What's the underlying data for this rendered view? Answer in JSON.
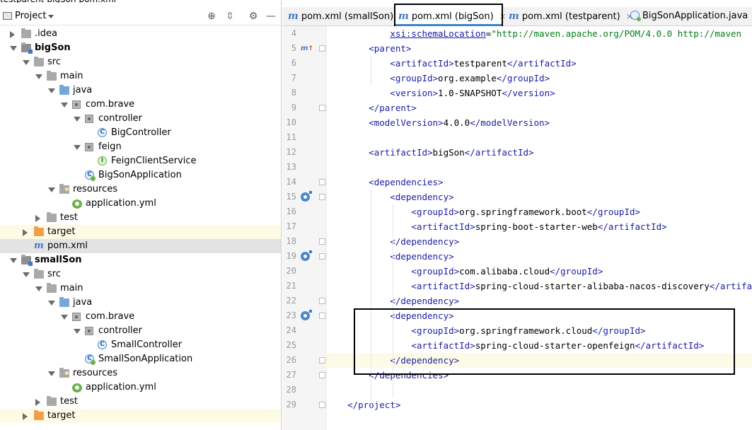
{
  "breadcrumb": [
    "testparent",
    "bigSon",
    "pom.xml"
  ],
  "project_panel": {
    "title": "Project",
    "tree": [
      {
        "label": ".idea",
        "icon": "folder-icon",
        "depth": 1,
        "arrow": "closed"
      },
      {
        "label": "bigSon",
        "icon": "module-folder-icon",
        "depth": 1,
        "arrow": "open",
        "bold": true
      },
      {
        "label": "src",
        "icon": "folder-icon",
        "depth": 2,
        "arrow": "open"
      },
      {
        "label": "main",
        "icon": "folder-icon",
        "depth": 3,
        "arrow": "open"
      },
      {
        "label": "java",
        "icon": "source-folder-icon",
        "depth": 4,
        "arrow": "open"
      },
      {
        "label": "com.brave",
        "icon": "package-icon",
        "depth": 5,
        "arrow": "open"
      },
      {
        "label": "controller",
        "icon": "package-icon",
        "depth": 6,
        "arrow": "open"
      },
      {
        "label": "BigController",
        "icon": "class-icon",
        "depth": 7
      },
      {
        "label": "feign",
        "icon": "package-icon",
        "depth": 6,
        "arrow": "open"
      },
      {
        "label": "FeignClientService",
        "icon": "interface-icon",
        "depth": 7
      },
      {
        "label": "BigSonApplication",
        "icon": "spring-app-icon",
        "depth": 6
      },
      {
        "label": "resources",
        "icon": "resources-folder-icon",
        "depth": 4,
        "arrow": "open"
      },
      {
        "label": "application.yml",
        "icon": "yml-icon",
        "depth": 5
      },
      {
        "label": "test",
        "icon": "folder-icon",
        "depth": 3,
        "arrow": "closed"
      },
      {
        "label": "target",
        "icon": "target-folder-icon",
        "depth": 2,
        "arrow": "closed",
        "highlight": "yellow"
      },
      {
        "label": "pom.xml",
        "icon": "maven-icon",
        "depth": 2,
        "highlight": "selected"
      },
      {
        "label": "smallSon",
        "icon": "module-folder-icon",
        "depth": 1,
        "arrow": "open",
        "bold": true
      },
      {
        "label": "src",
        "icon": "folder-icon",
        "depth": 2,
        "arrow": "open"
      },
      {
        "label": "main",
        "icon": "folder-icon",
        "depth": 3,
        "arrow": "open"
      },
      {
        "label": "java",
        "icon": "source-folder-icon",
        "depth": 4,
        "arrow": "open"
      },
      {
        "label": "com.brave",
        "icon": "package-icon",
        "depth": 5,
        "arrow": "open"
      },
      {
        "label": "controller",
        "icon": "package-icon",
        "depth": 6,
        "arrow": "open"
      },
      {
        "label": "SmallController",
        "icon": "class-icon",
        "depth": 7
      },
      {
        "label": "SmallSonApplication",
        "icon": "spring-app-icon",
        "depth": 6
      },
      {
        "label": "resources",
        "icon": "resources-folder-icon",
        "depth": 4,
        "arrow": "open"
      },
      {
        "label": "application.yml",
        "icon": "yml-icon",
        "depth": 5
      },
      {
        "label": "test",
        "icon": "folder-icon",
        "depth": 3,
        "arrow": "closed"
      },
      {
        "label": "target",
        "icon": "target-folder-icon",
        "depth": 2,
        "arrow": "closed",
        "highlight": "yellow"
      }
    ]
  },
  "editor": {
    "tabs": [
      {
        "label": "pom.xml (smallSon)",
        "icon": "maven-icon",
        "active": false
      },
      {
        "label": "pom.xml (bigSon)",
        "icon": "maven-icon",
        "active": true
      },
      {
        "label": "pom.xml (testparent)",
        "icon": "maven-icon",
        "active": false
      },
      {
        "label": "BigSonApplication.java",
        "icon": "spring-app-icon",
        "active": false
      }
    ],
    "current_line": 26,
    "lines": [
      {
        "n": 4,
        "indent": 8,
        "tokens": [
          [
            "attr",
            "xsi:schemaLocation"
          ],
          [
            "txt",
            "="
          ],
          [
            "str",
            "\"http://maven.apache.org/POM/4.0.0 http://maven"
          ]
        ]
      },
      {
        "n": 5,
        "indent": 4,
        "gutter": "maven-override-icon",
        "fold": true,
        "tokens": [
          [
            "tag",
            "<parent>"
          ]
        ]
      },
      {
        "n": 6,
        "indent": 8,
        "tokens": [
          [
            "tag",
            "<artifactId>"
          ],
          [
            "txt",
            "testparent"
          ],
          [
            "tag",
            "</artifactId>"
          ]
        ]
      },
      {
        "n": 7,
        "indent": 8,
        "tokens": [
          [
            "tag",
            "<groupId>"
          ],
          [
            "txt",
            "org.example"
          ],
          [
            "tag",
            "</groupId>"
          ]
        ]
      },
      {
        "n": 8,
        "indent": 8,
        "tokens": [
          [
            "tag",
            "<version>"
          ],
          [
            "txt",
            "1.0-SNAPSHOT"
          ],
          [
            "tag",
            "</version>"
          ]
        ]
      },
      {
        "n": 9,
        "indent": 4,
        "fold": true,
        "tokens": [
          [
            "tag",
            "</parent>"
          ]
        ]
      },
      {
        "n": 10,
        "indent": 4,
        "tokens": [
          [
            "tag",
            "<modelVersion>"
          ],
          [
            "txt",
            "4.0.0"
          ],
          [
            "tag",
            "</modelVersion>"
          ]
        ]
      },
      {
        "n": 11,
        "indent": 0,
        "tokens": []
      },
      {
        "n": 12,
        "indent": 4,
        "tokens": [
          [
            "tag",
            "<artifactId>"
          ],
          [
            "txt",
            "bigSon"
          ],
          [
            "tag",
            "</artifactId>"
          ]
        ]
      },
      {
        "n": 13,
        "indent": 0,
        "tokens": []
      },
      {
        "n": 14,
        "indent": 4,
        "fold": true,
        "tokens": [
          [
            "tag",
            "<dependencies>"
          ]
        ]
      },
      {
        "n": 15,
        "indent": 8,
        "gutter": "dependency-icon",
        "fold": true,
        "tokens": [
          [
            "tag",
            "<dependency>"
          ]
        ]
      },
      {
        "n": 16,
        "indent": 12,
        "tokens": [
          [
            "tag",
            "<groupId>"
          ],
          [
            "txt",
            "org.springframework.boot"
          ],
          [
            "tag",
            "</groupId>"
          ]
        ]
      },
      {
        "n": 17,
        "indent": 12,
        "tokens": [
          [
            "tag",
            "<artifactId>"
          ],
          [
            "txt",
            "spring-boot-starter-web"
          ],
          [
            "tag",
            "</artifactId>"
          ]
        ]
      },
      {
        "n": 18,
        "indent": 8,
        "fold": true,
        "tokens": [
          [
            "tag",
            "</dependency>"
          ]
        ]
      },
      {
        "n": 19,
        "indent": 8,
        "gutter": "dependency-icon",
        "fold": true,
        "tokens": [
          [
            "tag",
            "<dependency>"
          ]
        ]
      },
      {
        "n": 20,
        "indent": 12,
        "tokens": [
          [
            "tag",
            "<groupId>"
          ],
          [
            "txt",
            "com.alibaba.cloud"
          ],
          [
            "tag",
            "</groupId>"
          ]
        ]
      },
      {
        "n": 21,
        "indent": 12,
        "tokens": [
          [
            "tag",
            "<artifactId>"
          ],
          [
            "txt",
            "spring-cloud-starter-alibaba-nacos-discovery"
          ],
          [
            "tag",
            "</artifa"
          ]
        ]
      },
      {
        "n": 22,
        "indent": 8,
        "fold": true,
        "tokens": [
          [
            "tag",
            "</dependency>"
          ]
        ]
      },
      {
        "n": 23,
        "indent": 8,
        "gutter": "dependency-icon",
        "fold": true,
        "tokens": [
          [
            "tag",
            "<dependency>"
          ]
        ]
      },
      {
        "n": 24,
        "indent": 12,
        "tokens": [
          [
            "tag",
            "<groupId>"
          ],
          [
            "txt",
            "org.springframework.cloud"
          ],
          [
            "tag",
            "</groupId>"
          ]
        ]
      },
      {
        "n": 25,
        "indent": 12,
        "tokens": [
          [
            "tag",
            "<artifactId>"
          ],
          [
            "txt",
            "spring-cloud-starter-openfeign"
          ],
          [
            "tag",
            "</artifactId>"
          ]
        ]
      },
      {
        "n": 26,
        "indent": 8,
        "fold": true,
        "tokens": [
          [
            "tag",
            "</dependency>"
          ]
        ]
      },
      {
        "n": 27,
        "indent": 4,
        "fold": true,
        "tokens": [
          [
            "tag",
            "</dependencies>"
          ]
        ]
      },
      {
        "n": 28,
        "indent": 0,
        "tokens": []
      },
      {
        "n": 29,
        "indent": 0,
        "fold": true,
        "tokens": [
          [
            "tag",
            "</project>"
          ]
        ]
      }
    ]
  },
  "colors": {
    "tag": "#1c1ca5",
    "string": "#067d17",
    "selection": "#e3e3e3",
    "ignored_highlight": "#fdfbe6",
    "active_tab_underline": "#4083c9"
  }
}
